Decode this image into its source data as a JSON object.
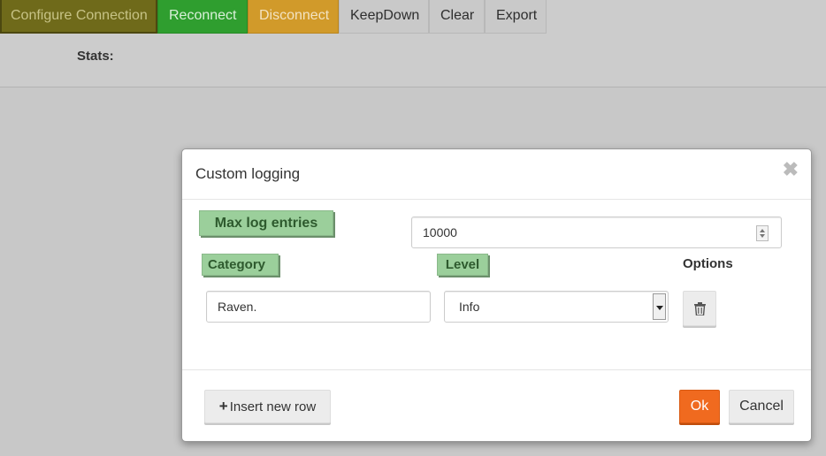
{
  "toolbar": {
    "configure_label": "Configure Connection",
    "reconnect_label": "Reconnect",
    "disconnect_label": "Disconnect",
    "keepdown_label": "KeepDown",
    "clear_label": "Clear",
    "export_label": "Export"
  },
  "stats": {
    "label": "Stats:"
  },
  "modal": {
    "title": "Custom logging",
    "close_symbol": "✖",
    "max_entries_label": "Max log entries",
    "max_entries_value": "10000",
    "columns": {
      "category": "Category",
      "level": "Level",
      "options": "Options"
    },
    "rows": [
      {
        "category": "Raven.",
        "level": "Info"
      }
    ],
    "footer": {
      "insert_label": "Insert new row",
      "insert_icon": "plus-icon",
      "ok_label": "Ok",
      "cancel_label": "Cancel"
    }
  },
  "colors": {
    "accent_orange": "#f06a1f",
    "label_green": "#9bcf9b",
    "reconnect_green": "#2f9e2f",
    "disconnect_amber": "#d19a2a"
  }
}
